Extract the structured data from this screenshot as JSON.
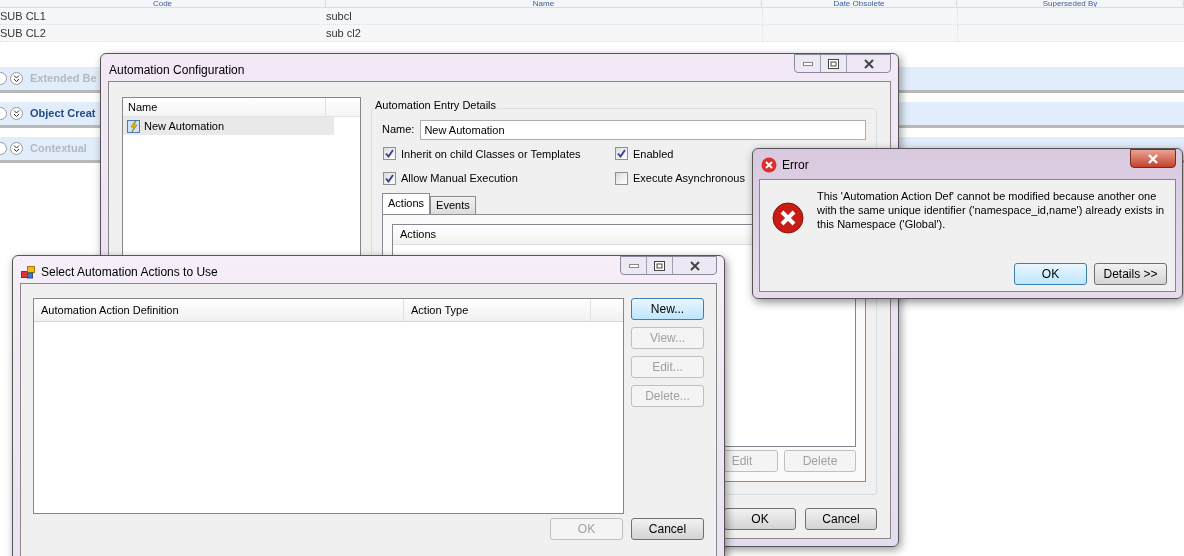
{
  "background_table": {
    "columns": [
      "Code",
      "Name",
      "Date Obsolete",
      "Superseded By"
    ],
    "rows": [
      {
        "code": "SUB CL1",
        "name": "subcl"
      },
      {
        "code": "SUB CL2",
        "name": "sub cl2"
      }
    ]
  },
  "sections": [
    {
      "label": "Extended Be",
      "disabled": true
    },
    {
      "label": "Object Creat",
      "disabled": false
    },
    {
      "label": "Contextual",
      "disabled": true
    }
  ],
  "automation_window": {
    "title": "Automation Configuration",
    "list_header": "Name",
    "items": [
      {
        "label": "New Automation",
        "selected": true
      }
    ],
    "group_title": "Automation Entry Details",
    "name_label": "Name:",
    "name_value": "New Automation",
    "options": [
      {
        "label": "Inherit on child Classes or Templates",
        "checked": true
      },
      {
        "label": "Enabled",
        "checked": true
      },
      {
        "label": "Allow Manual Execution",
        "checked": true
      },
      {
        "label": "Execute Asynchronous",
        "checked": false
      }
    ],
    "tabs": [
      {
        "label": "Actions",
        "selected": true
      },
      {
        "label": "Events",
        "selected": false
      }
    ],
    "actions_header": "Actions",
    "action_buttons": [
      {
        "label": "Edit",
        "disabled": true
      },
      {
        "label": "Delete",
        "disabled": true
      }
    ],
    "buttons": [
      {
        "label": "OK",
        "disabled": false
      },
      {
        "label": "Cancel",
        "disabled": false
      }
    ]
  },
  "select_window": {
    "title": "Select Automation Actions to Use",
    "columns": [
      "Automation Action Definition",
      "Action Type"
    ],
    "side_buttons": [
      {
        "label": "New...",
        "disabled": false
      },
      {
        "label": "View...",
        "disabled": true
      },
      {
        "label": "Edit...",
        "disabled": true
      },
      {
        "label": "Delete...",
        "disabled": true
      }
    ],
    "buttons": [
      {
        "label": "OK",
        "disabled": true
      },
      {
        "label": "Cancel",
        "disabled": false
      }
    ]
  },
  "error_window": {
    "title": "Error",
    "message": "This 'Automation Action Def' cannot be modified because another one with the same unique identifier ('namespace_id,name') already exists in this Namespace ('Global').",
    "buttons": [
      {
        "label": "OK",
        "disabled": false
      },
      {
        "label": "Details >>",
        "disabled": false
      }
    ]
  }
}
